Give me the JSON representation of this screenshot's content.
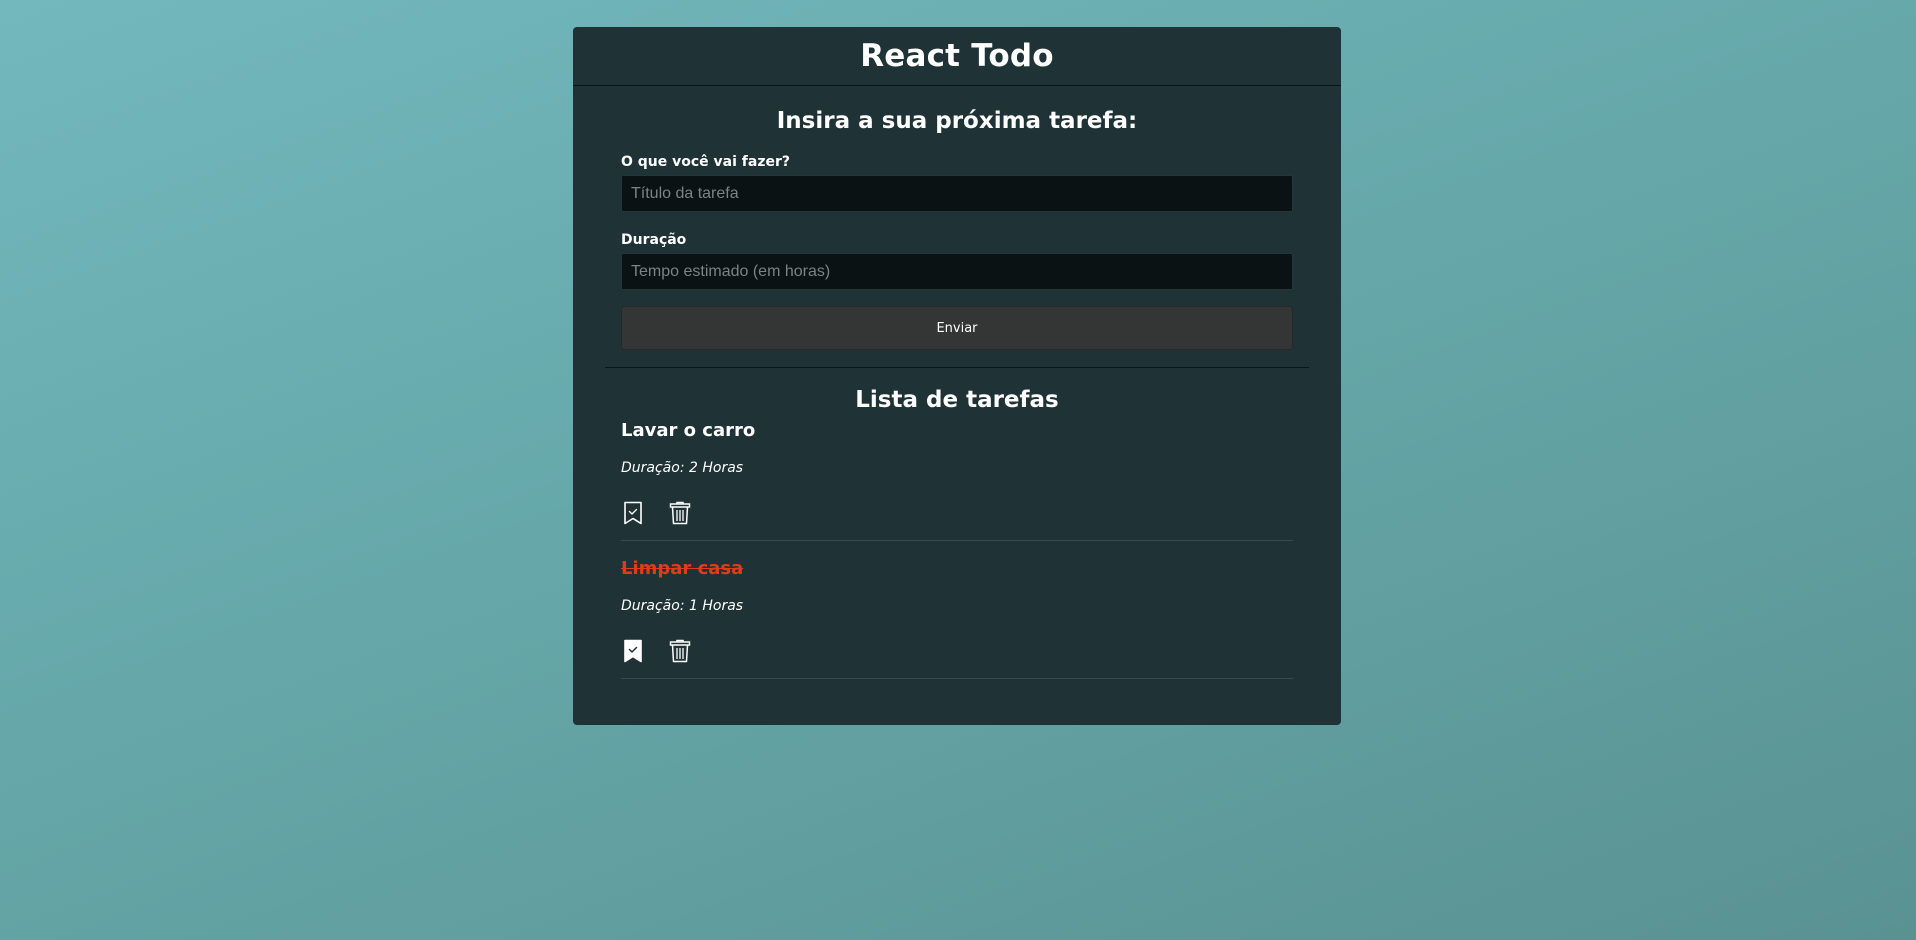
{
  "header": {
    "title": "React Todo"
  },
  "form": {
    "title": "Insira a sua próxima tarefa:",
    "title_label": "O que você vai fazer?",
    "title_placeholder": "Título da tarefa",
    "title_value": "",
    "duration_label": "Duração",
    "duration_placeholder": "Tempo estimado (em horas)",
    "duration_value": "",
    "submit_label": "Enviar"
  },
  "list": {
    "title": "Lista de tarefas",
    "tasks": [
      {
        "title": "Lavar o carro",
        "duration": "Duração: 2 Horas",
        "done": false,
        "done_icon": "bookmark-check-outline-icon",
        "delete_icon": "trash-icon"
      },
      {
        "title": "Limpar casa",
        "duration": "Duração: 1 Horas",
        "done": true,
        "done_icon": "bookmark-check-filled-icon",
        "delete_icon": "trash-icon"
      }
    ]
  },
  "colors": {
    "background_top": "#72b8bd",
    "background_bottom": "#5a9292",
    "panel": "#1f3235",
    "input_bg": "#0a1213",
    "button_bg": "#343535",
    "done_task": "#e03b1a",
    "text": "#ffffff"
  }
}
